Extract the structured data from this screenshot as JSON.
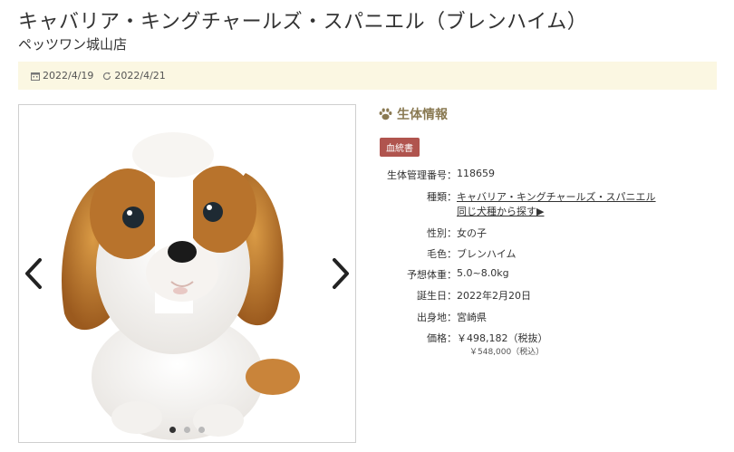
{
  "header": {
    "title": "キャバリア・キングチャールズ・スパニエル（ブレンハイム）",
    "shop": "ペッツワン城山店"
  },
  "dates": {
    "created": "2022/4/19",
    "updated": "2022/4/21",
    "created_icon": "calendar-icon",
    "updated_icon": "refresh-icon"
  },
  "gallery": {
    "image_alt": "cavalier-puppy-photo",
    "slides": 3,
    "active_index": 0
  },
  "info": {
    "heading": "生体情報",
    "badge": "血統書",
    "rows": [
      {
        "label": "生体管理番号：",
        "value": "118659"
      },
      {
        "label": "種類：",
        "value": "キャバリア・キングチャールズ・スパニエル",
        "link2": "同じ犬種から探す▶"
      },
      {
        "label": "性別：",
        "value": "女の子"
      },
      {
        "label": "毛色：",
        "value": "ブレンハイム"
      },
      {
        "label": "予想体重：",
        "value": "5.0~8.0kg"
      },
      {
        "label": "誕生日：",
        "value": "2022年2月20日"
      },
      {
        "label": "出身地：",
        "value": "宮崎県"
      },
      {
        "label": "価格：",
        "value": "￥498,182（税抜）",
        "sub": "￥548,000（税込）"
      }
    ]
  },
  "colors": {
    "accent": "#8a7a53",
    "badge": "#b0544e",
    "datebar": "#fbf7e2"
  }
}
